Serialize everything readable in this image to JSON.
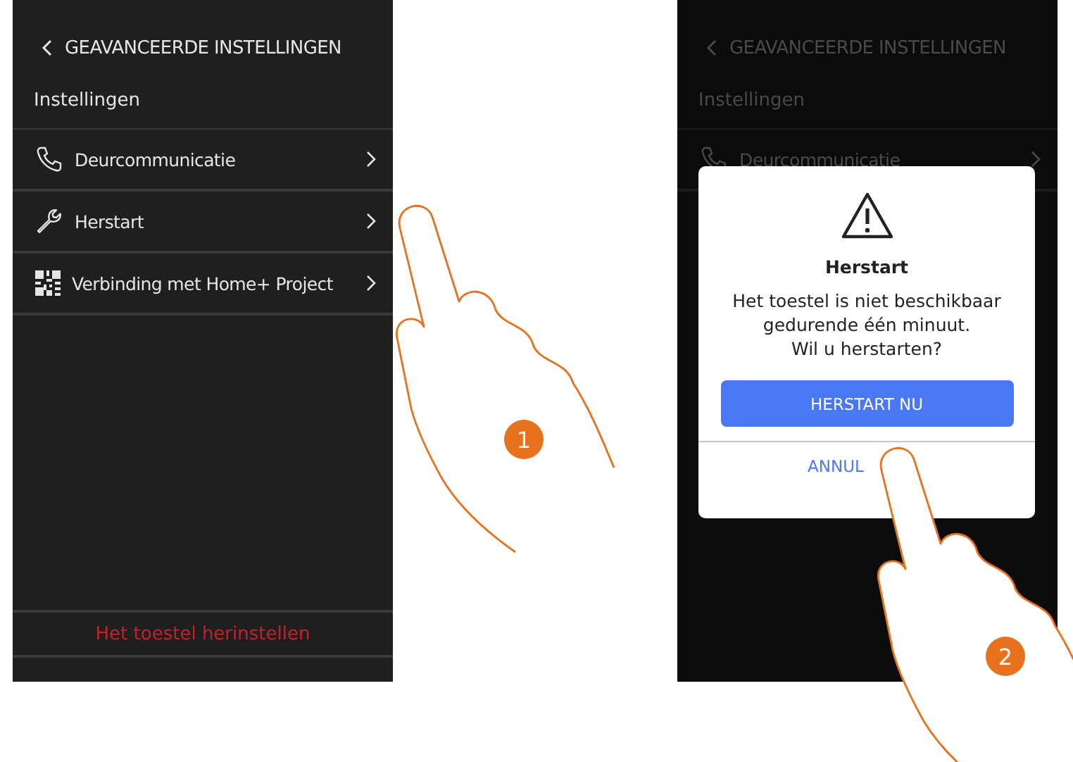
{
  "screens": [
    {
      "dimmed": false,
      "title": "GEAVANCEERDE INSTELLINGEN",
      "subtitle": "Instellingen",
      "rows": [
        {
          "kind": "phone",
          "label": "Deurcommunicatie"
        },
        {
          "kind": "wrench",
          "label": "Herstart"
        },
        {
          "kind": "qr",
          "label": "Verbinding met Home+ Project"
        }
      ],
      "footer_button": "Het toestel herinstellen"
    },
    {
      "dimmed": true,
      "title": "GEAVANCEERDE INSTELLINGEN",
      "subtitle": "Instellingen",
      "rows": [
        {
          "kind": "phone",
          "label": "Deurcommunicatie"
        }
      ],
      "dialog": {
        "title": "Herstart",
        "message": "Het toestel is niet beschikbaar\ngedurende één minuut.\nWil u herstarten?",
        "confirm": "HERSTART NU",
        "cancel": "ANNUL"
      }
    }
  ],
  "steps": [
    {
      "number": "1"
    },
    {
      "number": "2"
    }
  ]
}
